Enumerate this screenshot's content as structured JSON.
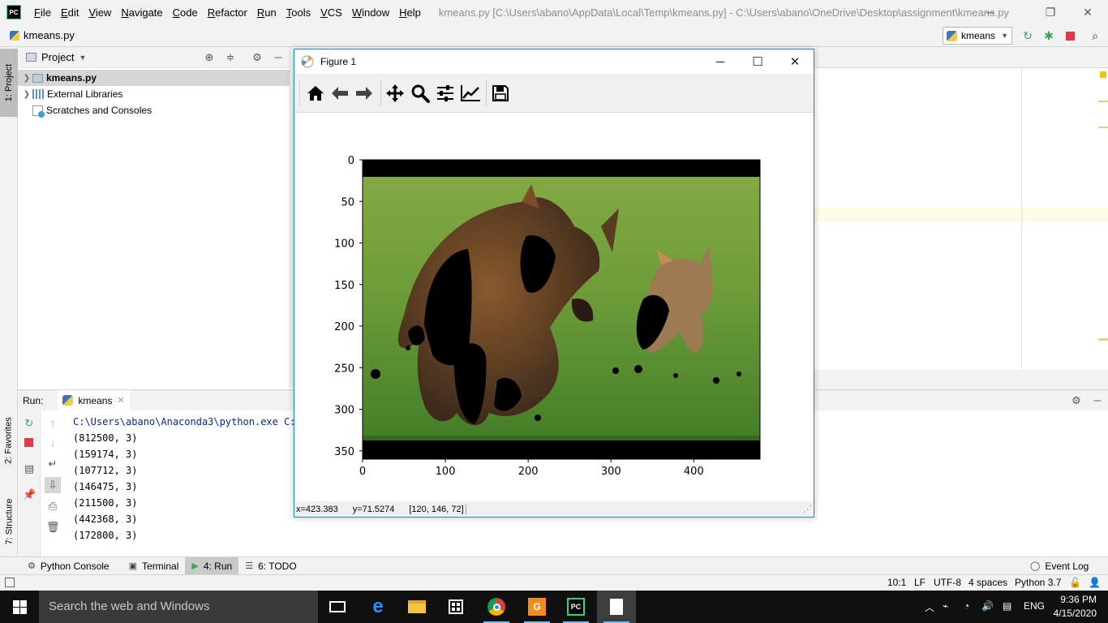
{
  "ide": {
    "menu": [
      "File",
      "Edit",
      "View",
      "Navigate",
      "Code",
      "Refactor",
      "Run",
      "Tools",
      "VCS",
      "Window",
      "Help"
    ],
    "window_title": "kmeans.py [C:\\Users\\abano\\AppData\\Local\\Temp\\kmeans.py] - C:\\Users\\abano\\OneDrive\\Desktop\\assignment\\kmeans.py",
    "logo_text": "PC",
    "breadcrumb": "kmeans.py",
    "run_config": "kmeans"
  },
  "left_strip": {
    "project_tab": "1: Project",
    "favorites_tab": "2: Favorites",
    "structure_tab": "7: Structure"
  },
  "project": {
    "title": "Project",
    "items": [
      {
        "label": "kmeans.py",
        "selected": true
      },
      {
        "label": "External Libraries",
        "selected": false
      },
      {
        "label": "Scratches and Consoles",
        "selected": false
      }
    ]
  },
  "run": {
    "label": "Run:",
    "tab": "kmeans",
    "console": [
      "C:\\Users\\abano\\Anaconda3\\python.exe C:/",
      "(812500, 3)",
      "(159174, 3)",
      "(107712, 3)",
      "(146475, 3)",
      "(211500, 3)",
      "(442368, 3)",
      "(172800, 3)"
    ]
  },
  "bottom_tabs": {
    "python_console": "Python Console",
    "terminal": "Terminal",
    "run": "4: Run",
    "todo": "6: TODO",
    "event_log": "Event Log"
  },
  "status": {
    "position": "10:1",
    "line_sep": "LF",
    "encoding": "UTF-8",
    "indent": "4 spaces",
    "interpreter": "Python 3.7"
  },
  "figure": {
    "title": "Figure 1",
    "x_ticks": [
      "0",
      "100",
      "200",
      "300",
      "400"
    ],
    "y_ticks": [
      "0",
      "50",
      "100",
      "150",
      "200",
      "250",
      "300",
      "350"
    ],
    "status_x": "x=423.383",
    "status_y": "y=71.5274",
    "status_pixel": "[120, 146, 72]"
  },
  "taskbar": {
    "search_placeholder": "Search the web and Windows",
    "lang": "ENG",
    "time": "9:36 PM",
    "date": "4/15/2020"
  },
  "colors": {
    "accent": "#1f8dd6",
    "grass": "#5f9a34",
    "console_cmd": "#0b2690"
  }
}
